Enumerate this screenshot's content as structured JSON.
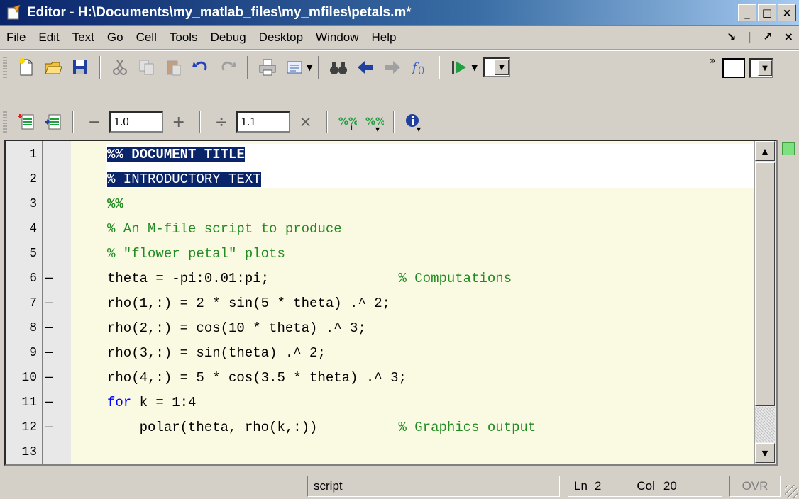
{
  "window": {
    "title": "Editor - H:\\Documents\\my_matlab_files\\my_mfiles\\petals.m*",
    "minimize": "_",
    "maximize": "□",
    "close": "×"
  },
  "menu": {
    "items": [
      "File",
      "Edit",
      "Text",
      "Go",
      "Cell",
      "Tools",
      "Debug",
      "Desktop",
      "Window",
      "Help"
    ],
    "dock_label": "↘",
    "undock_label": "↗",
    "close_label": "×"
  },
  "toolbar2": {
    "minus": "−",
    "increment_value": "1.0",
    "plus": "+",
    "divide": "÷",
    "scale_value": "1.1",
    "times": "×"
  },
  "editor": {
    "lines": [
      {
        "num": "1",
        "bp": "",
        "segments": [
          {
            "t": "%% ",
            "c": "cmt sel cellhdr"
          },
          {
            "t": "DOCUMENT TITLE",
            "c": "cmt sel cellhdr"
          }
        ]
      },
      {
        "num": "2",
        "bp": "",
        "segments": [
          {
            "t": "% INTRODUCTORY TEXT",
            "c": "cmt sel"
          }
        ]
      },
      {
        "num": "3",
        "bp": "",
        "segments": [
          {
            "t": "%%",
            "c": "cmt cellhdr"
          }
        ]
      },
      {
        "num": "4",
        "bp": "",
        "segments": [
          {
            "t": "% An M-file script to produce",
            "c": "cmt"
          }
        ]
      },
      {
        "num": "5",
        "bp": "",
        "segments": [
          {
            "t": "% \"flower petal\" plots",
            "c": "cmt"
          }
        ]
      },
      {
        "num": "6",
        "bp": "—",
        "segments": [
          {
            "t": "theta = -pi:0.01:pi;                % Computations",
            "c": "mixed6"
          }
        ]
      },
      {
        "num": "7",
        "bp": "—",
        "segments": [
          {
            "t": "rho(1,:) = 2 * sin(5 * theta) .^ 2;",
            "c": ""
          }
        ]
      },
      {
        "num": "8",
        "bp": "—",
        "segments": [
          {
            "t": "rho(2,:) = cos(10 * theta) .^ 3;",
            "c": ""
          }
        ]
      },
      {
        "num": "9",
        "bp": "—",
        "segments": [
          {
            "t": "rho(3,:) = sin(theta) .^ 2;",
            "c": ""
          }
        ]
      },
      {
        "num": "10",
        "bp": "—",
        "segments": [
          {
            "t": "rho(4,:) = 5 * cos(3.5 * theta) .^ 3;",
            "c": ""
          }
        ]
      },
      {
        "num": "11",
        "bp": "—",
        "segments": [
          {
            "t": "for",
            "c": "kw"
          },
          {
            "t": " k = 1:4",
            "c": ""
          }
        ]
      },
      {
        "num": "12",
        "bp": "—",
        "segments": [
          {
            "t": "    polar(theta, rho(k,:))          ",
            "c": ""
          },
          {
            "t": "% Graphics output",
            "c": "cmt"
          }
        ]
      },
      {
        "num": "13",
        "bp": "",
        "segments": []
      }
    ]
  },
  "status": {
    "mode": "script",
    "ln_label": "Ln",
    "ln_value": "2",
    "col_label": "Col",
    "col_value": "20",
    "ovr": "OVR"
  },
  "colors": {
    "comment": "#228b22",
    "keyword": "#0000ff",
    "selection": "#0a246a",
    "cell_bg": "#fafae3"
  }
}
